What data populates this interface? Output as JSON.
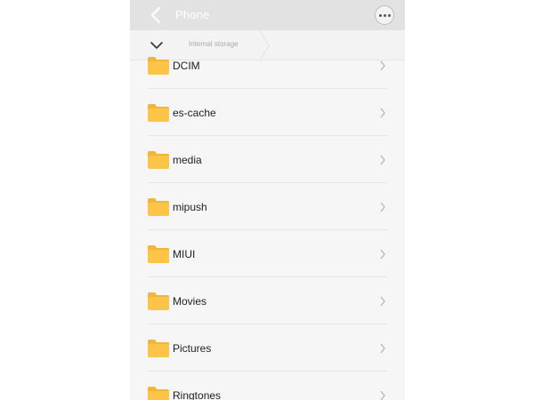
{
  "header": {
    "title": "Phone"
  },
  "breadcrumb": {
    "current": "Internal storage"
  },
  "folders": [
    {
      "name": "DCIM"
    },
    {
      "name": "es-cache"
    },
    {
      "name": "media"
    },
    {
      "name": "mipush"
    },
    {
      "name": "MIUI"
    },
    {
      "name": "Movies"
    },
    {
      "name": "Pictures"
    },
    {
      "name": "Ringtones"
    }
  ],
  "colors": {
    "folder": "#fcc449",
    "folder_tab": "#f3b43c",
    "header_bg": "#e2e2e2"
  },
  "icons": {
    "back": "chevron-left-icon",
    "more": "more-dots-icon",
    "toggle": "chevron-down-icon",
    "folder": "folder-icon",
    "row_chevron": "chevron-right-icon"
  }
}
